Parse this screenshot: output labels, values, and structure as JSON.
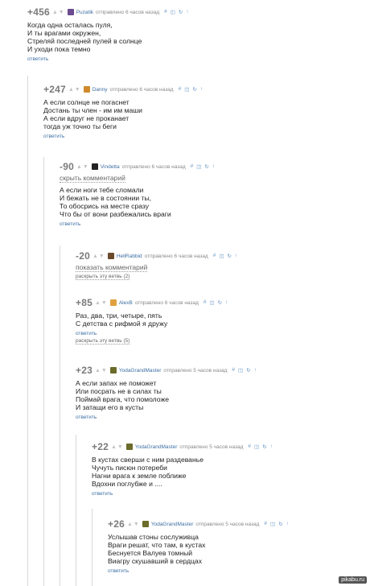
{
  "comments": [
    {
      "rating": "+456",
      "author": "Puzatik",
      "meta": "отправлено  6 часов назад",
      "body": "Когда одна осталась пуля,\nИ ты врагами окружен,\nСтреляй последней пулей в солнце\nИ уходи пока темно",
      "reply": "ответить",
      "avatar_color": "#6b4b8f"
    },
    {
      "rating": "+247",
      "author": "Danny",
      "meta": "отправлено  6 часов назад",
      "body": "А если солнце не погаснет\nДостань ты член - им им маши\nА если вдруг не проканает\nтогда уж точно ты беги",
      "reply": "ответить",
      "avatar_color": "#d08a2a"
    },
    {
      "rating": "-90",
      "author": "Vindetta",
      "meta": "отправлено  6 часов назад",
      "toggle": "скрыть комментарий",
      "body": "А если ноги тебе сломали\nИ бежать не в состоянии ты,\nТо обосрись на месте сразу\nЧто бы от вони разбежались враги",
      "reply": "ответить",
      "avatar_color": "#222222"
    },
    {
      "rating": "-20",
      "author": "HellRabbid",
      "meta": "отправлено  6 часов назад",
      "toggle": "показать комментарий",
      "branch": "раскрыть эту ветвь (2)",
      "avatar_color": "#6a4a2a"
    },
    {
      "rating": "+85",
      "author": "AlexB",
      "meta": "отправлено  6 часов назад",
      "body": "Раз, два, три, четыре, пять\nС детства с рифмой я дружу",
      "reply": "ответить",
      "branch": "раскрыть эту ветвь (5)",
      "avatar_color": "#e0a040"
    },
    {
      "rating": "+23",
      "author": "YodaGrandMaster",
      "meta": "отправлено  5 часов назад",
      "body": "А если запах не поможет\nИли посрать не в силах ты\nПоймай врага, что помоложе\nИ затащи его в кусты",
      "reply": "ответить",
      "avatar_color": "#6b6b2a"
    },
    {
      "rating": "+22",
      "author": "YodaGrandMaster",
      "meta": "отправлено  5 часов назад",
      "body": "В кустах сверши с ним раздеванье\nЧучуть писюн потереби\nНагни врага к земле поближе\nВдохни поглубже и ....",
      "reply": "ответить",
      "avatar_color": "#6b6b2a"
    },
    {
      "rating": "+26",
      "author": "YodaGrandMaster",
      "meta": "отправлено  5 часов назад",
      "body": "Услышав стоны сослуживца\nВраги решат, что там, в кустах\nБеснуется Валуев томный\nВиагру скушавший в сердцах",
      "reply": "ответить",
      "avatar_color": "#6b6b2a"
    }
  ],
  "actions": [
    "#",
    "◫",
    "↻",
    "↑"
  ],
  "watermark": "pikabu.ru"
}
